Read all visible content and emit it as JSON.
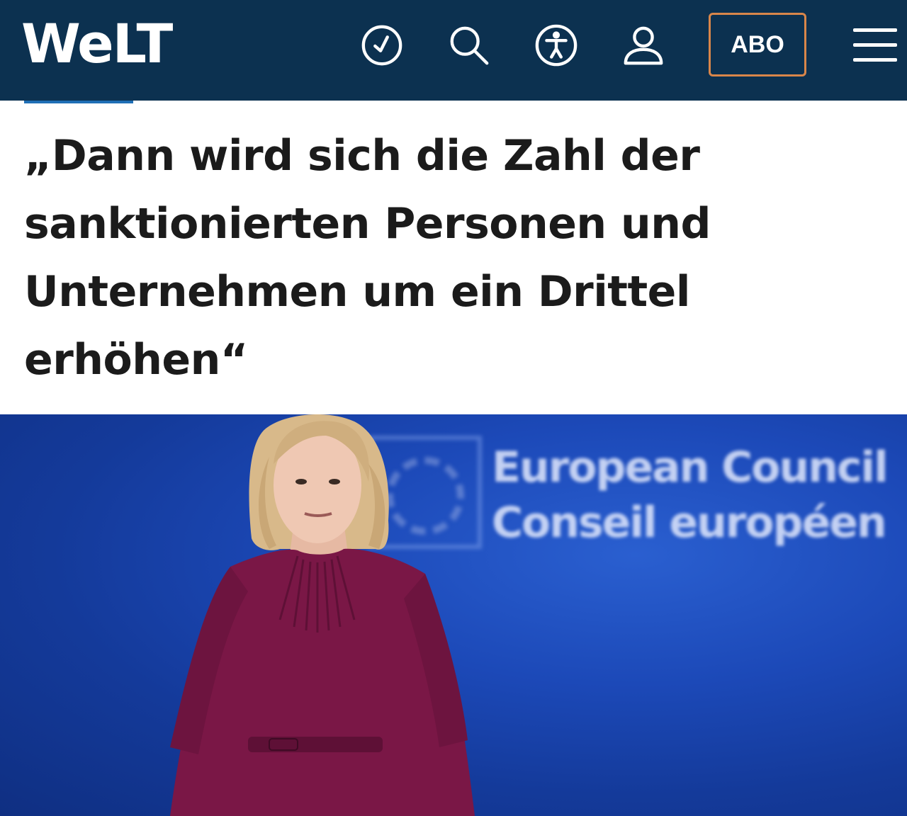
{
  "header": {
    "logo_text": "WeLT",
    "icons": [
      "clock-icon",
      "search-icon",
      "accessibility-icon",
      "user-icon",
      "menu-icon"
    ],
    "abo_label": "ABO",
    "colors": {
      "background": "#0c3150",
      "abo_border": "#d9864a",
      "section_accent": "#1f6fb6"
    }
  },
  "article": {
    "headline_lines": [
      "„Dann wird sich die Zahl der",
      "sanktionierten Personen und",
      "Unternehmen um ein Drittel",
      "erhöhen“"
    ]
  },
  "photo": {
    "backdrop_line1": "European Council",
    "backdrop_line2": "Conseil européen"
  }
}
